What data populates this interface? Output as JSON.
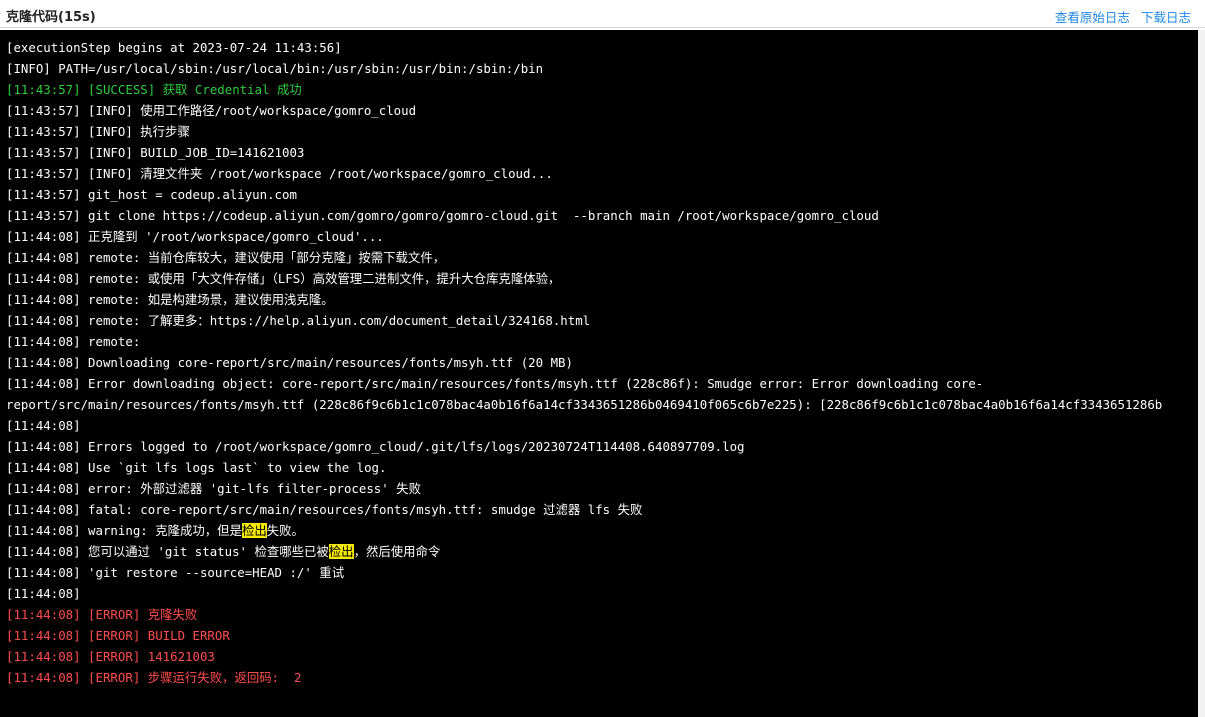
{
  "header": {
    "title": "克隆代码(15s)",
    "view_raw_log": "查看原始日志",
    "download_log": "下载日志"
  },
  "colors": {
    "success": "#2ecc40",
    "error": "#ff4d4f",
    "highlight": "#f5ea00",
    "link": "#1e88e5"
  },
  "log": {
    "lines": [
      {
        "text": "[executionStep begins at 2023-07-24 11:43:56]"
      },
      {
        "text": "[INFO] PATH=/usr/local/sbin:/usr/local/bin:/usr/sbin:/usr/bin:/sbin:/bin"
      },
      {
        "text": "[11:43:57] [SUCCESS] 获取 Credential 成功"
      },
      {
        "text": "[11:43:57] [INFO] 使用工作路径/root/workspace/gomro_cloud"
      },
      {
        "text": "[11:43:57] [INFO] 执行步骤"
      },
      {
        "text": "[11:43:57] [INFO] BUILD_JOB_ID=141621003"
      },
      {
        "text": "[11:43:57] [INFO] 清理文件夹 /root/workspace /root/workspace/gomro_cloud..."
      },
      {
        "text": "[11:43:57] git_host = codeup.aliyun.com"
      },
      {
        "text": "[11:43:57] git clone https://codeup.aliyun.com/gomro/gomro/gomro-cloud.git  --branch main /root/workspace/gomro_cloud"
      },
      {
        "text": "[11:44:08] 正克隆到 '/root/workspace/gomro_cloud'..."
      },
      {
        "text": "[11:44:08] remote: 当前仓库较大，建议使用「部分克隆」按需下载文件，"
      },
      {
        "text": "[11:44:08] remote: 或使用「大文件存储」（LFS）高效管理二进制文件，提升大仓库克隆体验，"
      },
      {
        "text": "[11:44:08] remote: 如是构建场景，建议使用浅克隆。"
      },
      {
        "text": "[11:44:08] remote: 了解更多：https://help.aliyun.com/document_detail/324168.html"
      },
      {
        "text": "[11:44:08] remote:"
      },
      {
        "text": "[11:44:08] Downloading core-report/src/main/resources/fonts/msyh.ttf (20 MB)"
      },
      {
        "text": "[11:44:08] Error downloading object: core-report/src/main/resources/fonts/msyh.ttf (228c86f): Smudge error: Error downloading core-"
      },
      {
        "text": "report/src/main/resources/fonts/msyh.ttf (228c86f9c6b1c1c078bac4a0b16f6a14cf3343651286b0469410f065c6b7e225): [228c86f9c6b1c1c078bac4a0b16f6a14cf3343651286b"
      },
      {
        "text": "[11:44:08]"
      },
      {
        "text": "[11:44:08] Errors logged to /root/workspace/gomro_cloud/.git/lfs/logs/20230724T114408.640897709.log"
      },
      {
        "text": "[11:44:08] Use `git lfs logs last` to view the log."
      },
      {
        "text": "[11:44:08] error: 外部过滤器 'git-lfs filter-process' 失败"
      },
      {
        "text": "[11:44:08] fatal: core-report/src/main/resources/fonts/msyh.ttf: smudge 过滤器 lfs 失败"
      },
      {
        "pre": "[11:44:08] warning: 克隆成功，但是",
        "hl": "检出",
        "post": "失败。"
      },
      {
        "pre": "[11:44:08] 您可以通过 'git status' 检查哪些已被",
        "hl": "检出",
        "post": "，然后使用命令"
      },
      {
        "text": "[11:44:08] 'git restore --source=HEAD :/' 重试"
      },
      {
        "text": "[11:44:08]"
      },
      {
        "text": "[11:44:08] [ERROR] 克隆失败"
      },
      {
        "text": "[11:44:08] [ERROR] BUILD ERROR"
      },
      {
        "text": "[11:44:08] [ERROR] 141621003"
      },
      {
        "text": "[11:44:08] [ERROR] 步骤运行失败，返回码:  2"
      }
    ]
  }
}
